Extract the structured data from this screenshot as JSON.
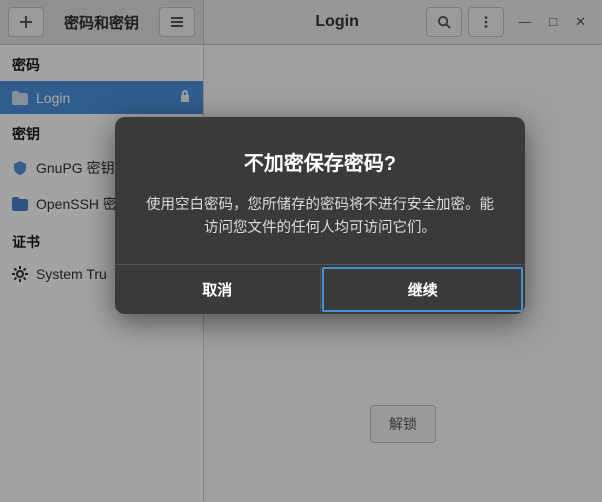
{
  "titlebar": {
    "left_title": "密码和密钥",
    "right_title": "Login"
  },
  "window_controls": {
    "min": "—",
    "max": "□",
    "close": "✕"
  },
  "sidebar": {
    "sections": [
      {
        "header": "密码",
        "items": [
          {
            "label": "Login",
            "icon": "folder",
            "selected": true,
            "locked": true
          }
        ]
      },
      {
        "header": "密钥",
        "items": [
          {
            "label": "GnuPG 密钥",
            "icon": "gnupg"
          },
          {
            "label": "OpenSSH 密",
            "icon": "folder-blue"
          }
        ]
      },
      {
        "header": "证书",
        "items": [
          {
            "label": "System Tru",
            "icon": "gear"
          }
        ]
      }
    ]
  },
  "main": {
    "unlock_button": "解锁"
  },
  "dialog": {
    "title": "不加密保存密码?",
    "message": "使用空白密码，您所储存的密码将不进行安全加密。能访问您文件的任何人均可访问它们。",
    "cancel": "取消",
    "continue": "继续"
  }
}
